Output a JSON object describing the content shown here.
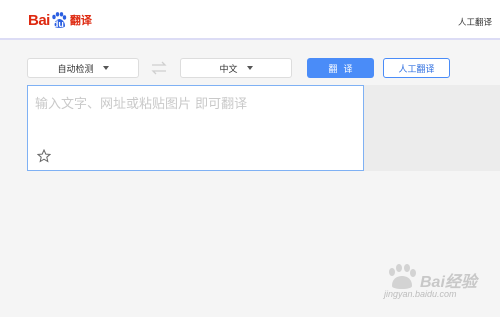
{
  "header": {
    "logo_text_bai": "Bai",
    "logo_text_du": "du",
    "logo_text_fanyi": "翻译",
    "right_link": "人工翻译"
  },
  "toolbar": {
    "source_lang": "自动检测",
    "target_lang": "中文",
    "translate_button": "翻译",
    "human_translate_button": "人工翻译"
  },
  "input": {
    "placeholder": "输入文字、网址或粘贴图片 即可翻译"
  },
  "watermark": {
    "text": "Bai经验",
    "url": "jingyan.baidu.com"
  },
  "colors": {
    "accent": "#4a8cf8",
    "brand_red": "#de2910",
    "brand_blue": "#2b5fe1"
  },
  "icons": {
    "swap": "swap-arrows-icon",
    "favorite": "star-icon",
    "dropdown": "chevron-down-icon"
  }
}
